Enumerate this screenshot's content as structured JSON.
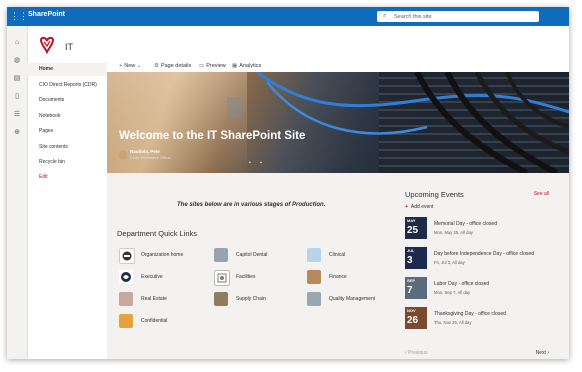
{
  "topbar": {
    "brand": "SharePoint",
    "waffle_icon": "waffle-icon",
    "search_placeholder": "Search this site"
  },
  "rail_icons": [
    "home-icon",
    "globe-icon",
    "news-icon",
    "document-icon",
    "list-icon",
    "add-icon"
  ],
  "site": {
    "name": "IT",
    "accent": "#c50f1f",
    "brand_color": "#0f6cbd"
  },
  "nav": [
    {
      "label": "Home"
    },
    {
      "label": "CIO Direct Reports (CDR)"
    },
    {
      "label": "Documents"
    },
    {
      "label": "Notebook"
    },
    {
      "label": "Pages"
    },
    {
      "label": "Site contents"
    },
    {
      "label": "Recycle bin"
    },
    {
      "label": "Edit"
    }
  ],
  "commands": {
    "new": "New",
    "page_details": "Page details",
    "preview": "Preview",
    "analytics": "Analytics"
  },
  "hero": {
    "title": "Welcome to the IT SharePoint Site",
    "author": "Rautiola, Pete",
    "role": "Chief Information Officer"
  },
  "note": "The sites below are in various stages of Production.",
  "quick_links": {
    "title": "Department Quick Links",
    "items": [
      {
        "label": "Organization home",
        "color": "#444444"
      },
      {
        "label": "Capitol Dental",
        "color": "#9aa3ad"
      },
      {
        "label": "Clinical",
        "color": "#b9d3e8"
      },
      {
        "label": "Executive",
        "color": "#1b2f4a"
      },
      {
        "label": "Facilities",
        "color": "#7d7d7d"
      },
      {
        "label": "Finance",
        "color": "#b88a5a"
      },
      {
        "label": "Real Estate",
        "color": "#c7a7a0"
      },
      {
        "label": "Supply Chain",
        "color": "#8f7d5e"
      },
      {
        "label": "Quality Management",
        "color": "#9aa6b3"
      },
      {
        "label": "Confidential",
        "color": "#e7a23a"
      }
    ]
  },
  "events": {
    "title": "Upcoming Events",
    "see_all": "See all",
    "add": "Add event",
    "items": [
      {
        "mon": "MAY",
        "day": "25",
        "name": "Memorial Day - office closed",
        "when": "Mon, May 25, All day",
        "color": "#1f2a44"
      },
      {
        "mon": "JUL",
        "day": "3",
        "name": "Day before Independence Day - office closed",
        "when": "Fri, Jul 3, All day",
        "color": "#1c2a4e"
      },
      {
        "mon": "SEP",
        "day": "7",
        "name": "Labor Day - office closed",
        "when": "Mon, Sep 7, All day",
        "color": "#5a6b7c"
      },
      {
        "mon": "NOV",
        "day": "26",
        "name": "Thanksgiving Day - office closed",
        "when": "Thu, Nov 26, All day",
        "color": "#7a4a2e"
      }
    ],
    "prev": "Previous",
    "next": "Next"
  }
}
